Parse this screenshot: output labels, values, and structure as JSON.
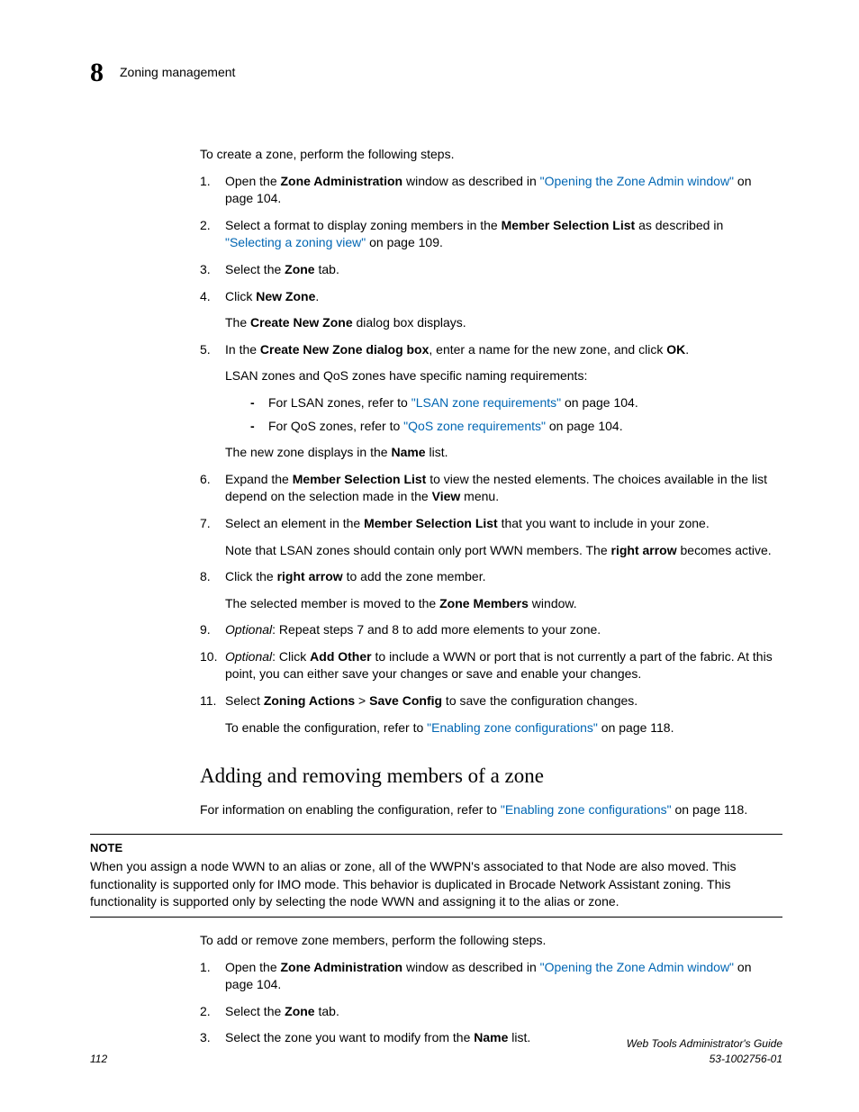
{
  "header": {
    "chapter_number": "8",
    "chapter_title": "Zoning management"
  },
  "intro": "To create a zone, perform the following steps.",
  "steps": {
    "s1_a": "Open the ",
    "s1_b": "Zone Administration",
    "s1_c": " window as described in ",
    "s1_link": "\"Opening the Zone Admin window\"",
    "s1_d": " on page 104.",
    "s2_a": "Select a format to display zoning members in the ",
    "s2_b": "Member Selection List",
    "s2_c": " as described in ",
    "s2_link": "\"Selecting a zoning view\"",
    "s2_d": " on page 109.",
    "s3_a": "Select the ",
    "s3_b": "Zone",
    "s3_c": " tab.",
    "s4_a": "Click ",
    "s4_b": "New Zone",
    "s4_c": ".",
    "s4_sub_a": "The ",
    "s4_sub_b": "Create New Zone",
    "s4_sub_c": " dialog box displays.",
    "s5_a": "In the ",
    "s5_b": "Create New Zone dialog box",
    "s5_c": ", enter a name for the new zone, and click ",
    "s5_d": "OK",
    "s5_e": ".",
    "s5_sub1": "LSAN zones and QoS zones have specific naming requirements:",
    "s5_dash1_a": "For LSAN zones, refer to ",
    "s5_dash1_link": "\"LSAN zone requirements\"",
    "s5_dash1_b": " on page 104.",
    "s5_dash2_a": "For QoS zones, refer to ",
    "s5_dash2_link": "\"QoS zone requirements\"",
    "s5_dash2_b": " on page 104.",
    "s5_sub2_a": "The new zone displays in the ",
    "s5_sub2_b": "Name",
    "s5_sub2_c": " list.",
    "s6_a": "Expand the ",
    "s6_b": "Member Selection List",
    "s6_c": " to view the nested elements. The choices available in the list depend on the selection made in the ",
    "s6_d": "View",
    "s6_e": " menu.",
    "s7_a": "Select an element in the ",
    "s7_b": "Member Selection List",
    "s7_c": " that you want to include in your zone.",
    "s7_sub_a": "Note that LSAN zones should contain only port WWN members. The ",
    "s7_sub_b": "right arrow",
    "s7_sub_c": " becomes active.",
    "s8_a": "Click the ",
    "s8_b": "right arrow",
    "s8_c": " to add the zone member.",
    "s8_sub_a": "The selected member is moved to the ",
    "s8_sub_b": "Zone Members",
    "s8_sub_c": " window.",
    "s9_a": "Optional",
    "s9_b": ": Repeat steps 7 and 8 to add more elements to your zone.",
    "s10_a": "Optional",
    "s10_b": ": Click ",
    "s10_c": "Add Other",
    "s10_d": " to include a WWN or port that is not currently a part of the fabric. At this point, you can either save your changes or save and enable your changes.",
    "s11_a": "Select ",
    "s11_b": "Zoning Actions",
    "s11_c": " > ",
    "s11_d": "Save Config",
    "s11_e": " to save the configuration changes.",
    "s11_sub_a": "To enable the configuration, refer to ",
    "s11_sub_link": "\"Enabling zone configurations\"",
    "s11_sub_b": " on page 118."
  },
  "section2": {
    "heading": "Adding and removing members of a zone",
    "para_a": "For information on enabling the configuration, refer to ",
    "para_link": "\"Enabling zone configurations\"",
    "para_b": " on page 118.",
    "note_label": "NOTE",
    "note_text": "When you assign a node WWN to an alias or zone, all of the WWPN's associated to that Node are also moved. This functionality is supported only for IMO mode. This behavior is duplicated in Brocade Network Assistant zoning. This functionality is supported only by selecting the node WWN and assigning it to the alias or zone.",
    "intro2": "To add or remove zone members, perform the following steps.",
    "b1_a": "Open the ",
    "b1_b": "Zone Administration",
    "b1_c": " window as described in ",
    "b1_link": "\"Opening the Zone Admin window\"",
    "b1_d": " on page 104.",
    "b2_a": "Select the ",
    "b2_b": "Zone",
    "b2_c": " tab.",
    "b3_a": "Select the zone you want to modify from the ",
    "b3_b": "Name",
    "b3_c": " list."
  },
  "footer": {
    "page_number": "112",
    "doc_title": "Web Tools Administrator's Guide",
    "doc_id": "53-1002756-01"
  }
}
